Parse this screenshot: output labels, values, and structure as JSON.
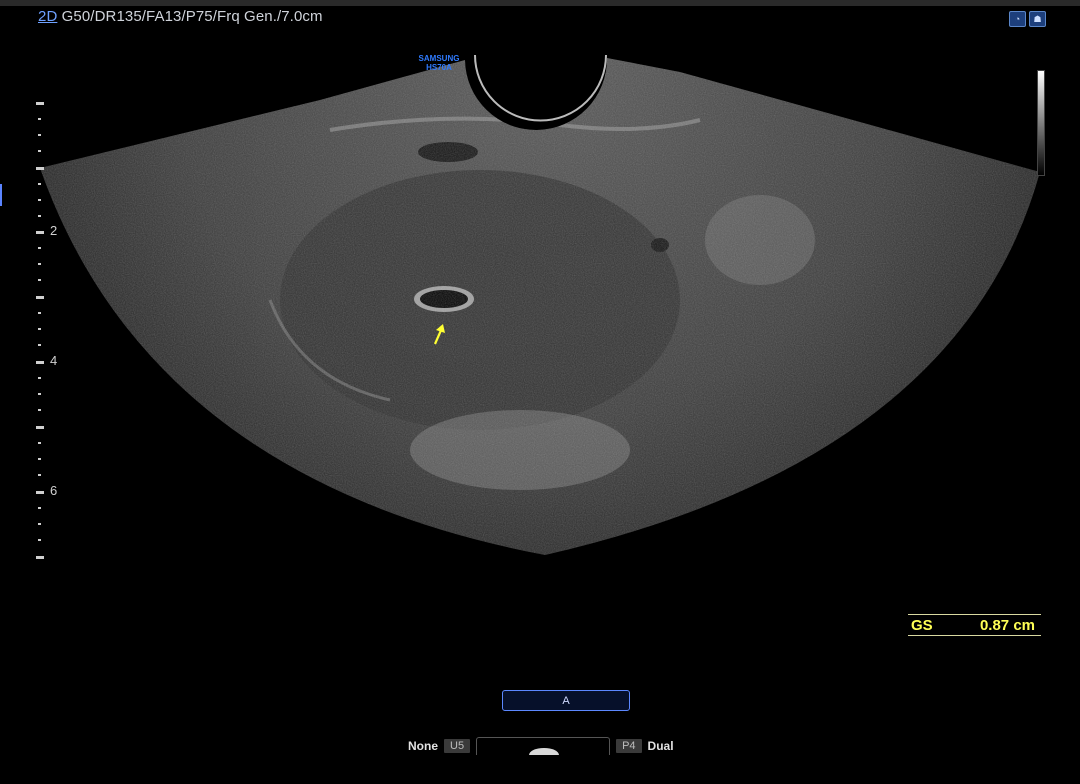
{
  "header": {
    "mode": "2D",
    "params": "G50/DR135/FA13/P75/Frq Gen./7.0cm",
    "icons": [
      "probe-icon",
      "fetus-icon"
    ]
  },
  "brand": {
    "line1": "SAMSUNG",
    "line2": "HS70A"
  },
  "depth_scale": {
    "labels": [
      "2",
      "4",
      "6"
    ]
  },
  "measurement": {
    "label": "GS",
    "value": "0.87 cm",
    "color": "#ffff55"
  },
  "controls": {
    "a_button": "A",
    "left_label": "None",
    "left_chip": "U5",
    "right_chip": "P4",
    "right_label": "Dual"
  },
  "colors": {
    "accent": "#5c88ff",
    "arrow": "#ffff33"
  }
}
